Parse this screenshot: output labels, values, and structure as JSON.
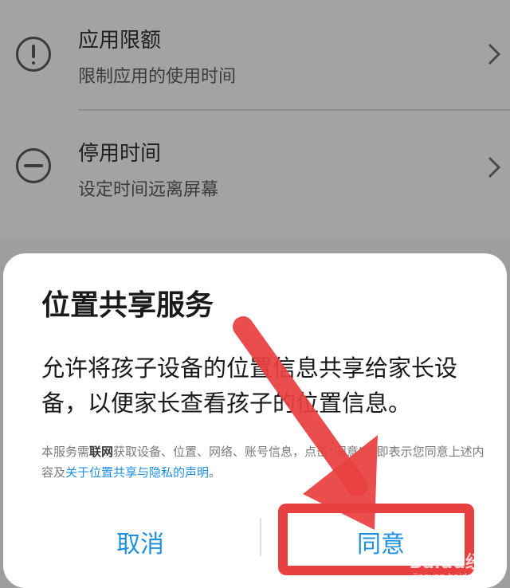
{
  "list": {
    "items": [
      {
        "title": "应用限额",
        "subtitle": "限制应用的使用时间",
        "icon": "exclamation-circle-icon"
      },
      {
        "title": "停用时间",
        "subtitle": "设定时间远离屏幕",
        "icon": "minus-circle-icon"
      }
    ]
  },
  "dialog": {
    "title": "位置共享服务",
    "message": "允许将孩子设备的位置信息共享给家长设备，以便家长查看孩子的位置信息。",
    "note_prefix": "本服务需",
    "note_bold": "联网",
    "note_middle": "获取设备、位置、网络、账号信息，点击“同意”，即表示您同意上述内容及",
    "note_link": "关于位置共享与隐私的声明",
    "note_suffix": "。",
    "cancel_label": "取消",
    "agree_label": "同意"
  },
  "overlay": {
    "arrow_color": "#e84040",
    "watermark": "Baidu经验",
    "watermark_url": "jingyan.baidu.com"
  },
  "colors": {
    "accent": "#1f8fe0",
    "dim_background": "#a3a3a3"
  }
}
